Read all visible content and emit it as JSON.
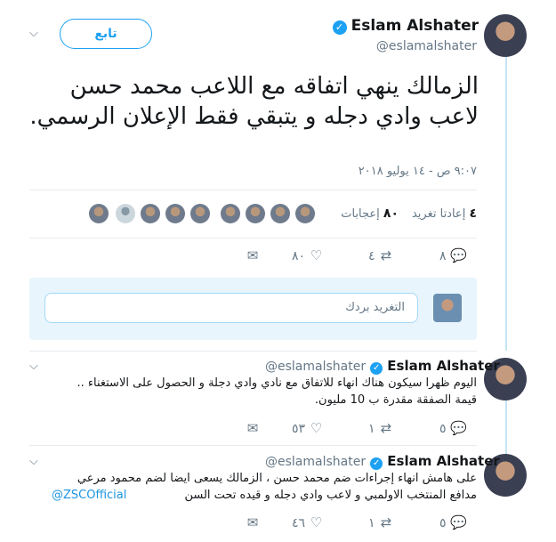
{
  "main_tweet": {
    "author_name": "Eslam Alshater",
    "author_handle": "@eslamalshater",
    "follow_label": "تابع",
    "text": "الزمالك ينهي اتفاقه مع اللاعب محمد حسن لاعب وادي دجله و يتبقي فقط الإعلان الرسمي.",
    "timestamp": "٩:٠٧ ص - ١٤ يوليو ٢٠١٨",
    "retweets_label": "إعادتا تغريد",
    "retweets_count": "٤",
    "likes_label": "إعجابات",
    "likes_count": "٨٠",
    "actions": {
      "replies": "٨",
      "retweets": "٤",
      "likes": "٨٠"
    }
  },
  "reply_box": {
    "placeholder": "التغريد بردك"
  },
  "thread": [
    {
      "author_name": "Eslam Alshater",
      "author_handle": "@eslamalshater",
      "line1": "اليوم ظهرا سيكون هناك انهاء للاتفاق مع نادي وادي دجلة و الحصول على الاستغناء ..",
      "line2": "قيمة الصفقة مقدرة ب 10 مليون.",
      "actions": {
        "replies": "٥",
        "retweets": "١",
        "likes": "٥٣"
      }
    },
    {
      "author_name": "Eslam Alshater",
      "author_handle": "@eslamalshater",
      "line1": "على هامش انهاء إجراءات ضم محمد حسن ، الزمالك يسعى ايضا لضم محمود مرعي",
      "line2": "مدافع المنتخب الاولمبي و لاعب وادي دجله و قيده تحت السن",
      "mention": "@ZSCOfficial",
      "actions": {
        "replies": "٥",
        "retweets": "١",
        "likes": "٤٦"
      }
    }
  ],
  "icons": {
    "verified": "verified-badge-icon",
    "chevron": "chevron-down-icon",
    "reply": "reply-icon",
    "retweet": "retweet-icon",
    "like": "heart-icon",
    "dm": "envelope-icon"
  },
  "colors": {
    "accent": "#1da1f2",
    "muted": "#657786",
    "thread_line": "#c4e4f4",
    "reply_bg": "#e8f5fd"
  }
}
